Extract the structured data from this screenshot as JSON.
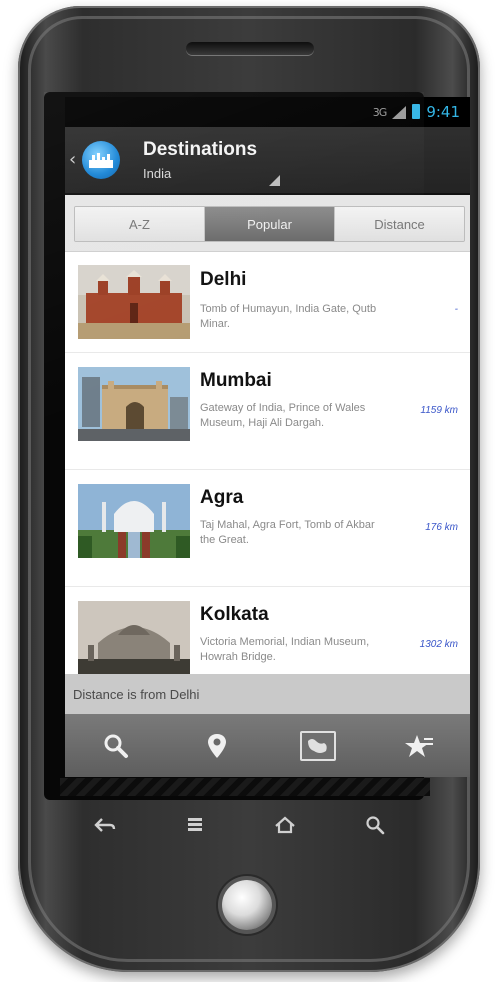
{
  "status_bar": {
    "signal": "3G",
    "time": "9:41"
  },
  "action_bar": {
    "title": "Destinations",
    "subtitle": "India"
  },
  "tabs": [
    {
      "label": "A-Z",
      "active": false
    },
    {
      "label": "Popular",
      "active": true
    },
    {
      "label": "Distance",
      "active": false
    }
  ],
  "destinations": [
    {
      "name": "Delhi",
      "description": "Tomb of Humayun, India Gate, Qutb Minar.",
      "distance": "-"
    },
    {
      "name": "Mumbai",
      "description": "Gateway of India, Prince of Wales Museum, Haji Ali Dargah.",
      "distance": "1159 km"
    },
    {
      "name": "Agra",
      "description": "Taj Mahal, Agra Fort, Tomb of Akbar the Great.",
      "distance": "176 km"
    },
    {
      "name": "Kolkata",
      "description": "Victoria Memorial, Indian Museum, Howrah Bridge.",
      "distance": "1302 km"
    }
  ],
  "footer_note": "Distance is from Delhi",
  "bottom_bar_icons": [
    "search-icon",
    "location-pin-icon",
    "map-icon",
    "favorite-star-icon"
  ],
  "hardware_keys": [
    "back-key",
    "menu-key",
    "home-key",
    "search-key"
  ],
  "colors": {
    "accent_blue": "#33b5e5",
    "distance_blue": "#3a56c9",
    "action_bar": "#2a2a2a",
    "active_tab": "#7a7a7a"
  }
}
